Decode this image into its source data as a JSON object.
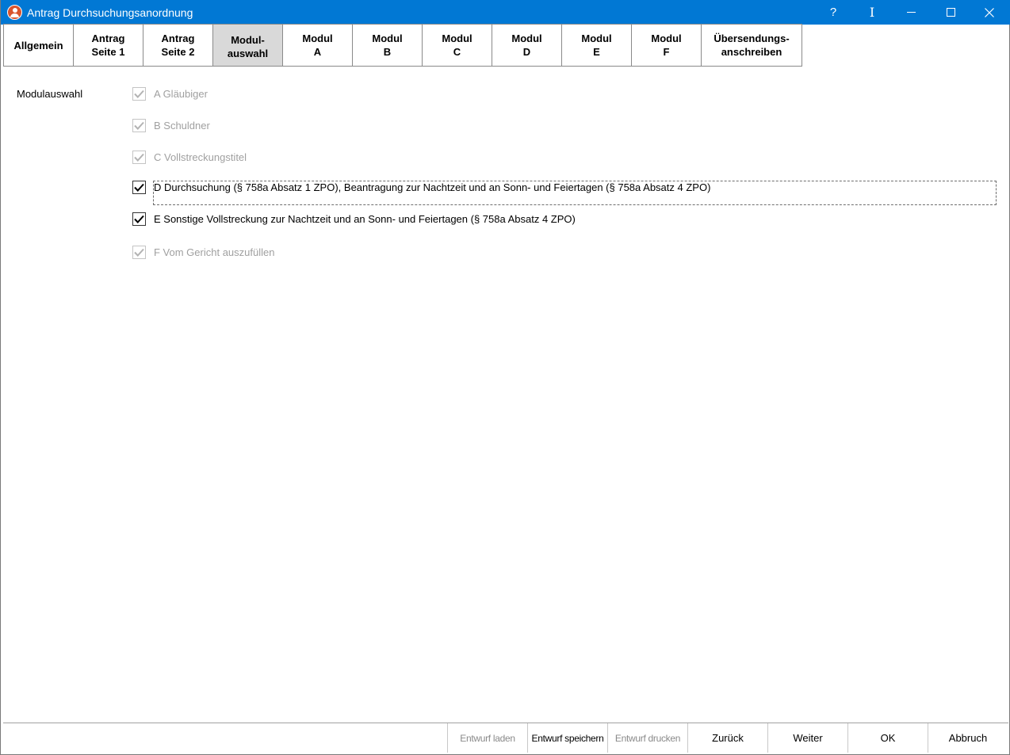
{
  "window": {
    "title": "Antrag Durchsuchungsanordnung",
    "accent_color": "#0178d4",
    "controls": {
      "help": "?",
      "cursor": "I"
    }
  },
  "tabs": [
    {
      "label": "Allgemein",
      "active": false
    },
    {
      "label": "Antrag\nSeite 1",
      "active": false
    },
    {
      "label": "Antrag\nSeite 2",
      "active": false
    },
    {
      "label": "Modul-\nauswahl",
      "active": true
    },
    {
      "label": "Modul\nA",
      "active": false
    },
    {
      "label": "Modul\nB",
      "active": false
    },
    {
      "label": "Modul\nC",
      "active": false
    },
    {
      "label": "Modul\nD",
      "active": false
    },
    {
      "label": "Modul\nE",
      "active": false
    },
    {
      "label": "Modul\nF",
      "active": false
    },
    {
      "label": "Übersendungs-\nanschreiben",
      "active": false
    }
  ],
  "module_selection": {
    "label": "Modulauswahl",
    "options": [
      {
        "label": "A Gläubiger",
        "checked": true,
        "enabled": false
      },
      {
        "label": "B Schuldner",
        "checked": true,
        "enabled": false
      },
      {
        "label": "C Vollstreckungstitel",
        "checked": true,
        "enabled": false
      },
      {
        "label": "D Durchsuchung (§ 758a Absatz 1 ZPO), Beantragung zur Nachtzeit und an Sonn- und Feiertagen (§ 758a Absatz 4 ZPO)",
        "checked": true,
        "enabled": true,
        "focused": true
      },
      {
        "label": "E Sonstige Vollstreckung zur Nachtzeit und an Sonn- und Feiertagen (§ 758a Absatz 4 ZPO)",
        "checked": true,
        "enabled": true
      },
      {
        "label": "F Vom Gericht auszufüllen",
        "checked": true,
        "enabled": false
      }
    ]
  },
  "footer": {
    "buttons": [
      {
        "label": "Entwurf laden",
        "enabled": false
      },
      {
        "label": "Entwurf speichern",
        "enabled": true
      },
      {
        "label": "Entwurf drucken",
        "enabled": false
      },
      {
        "label": "Zurück",
        "enabled": true
      },
      {
        "label": "Weiter",
        "enabled": true
      },
      {
        "label": "OK",
        "enabled": true
      },
      {
        "label": "Abbruch",
        "enabled": true
      }
    ]
  }
}
